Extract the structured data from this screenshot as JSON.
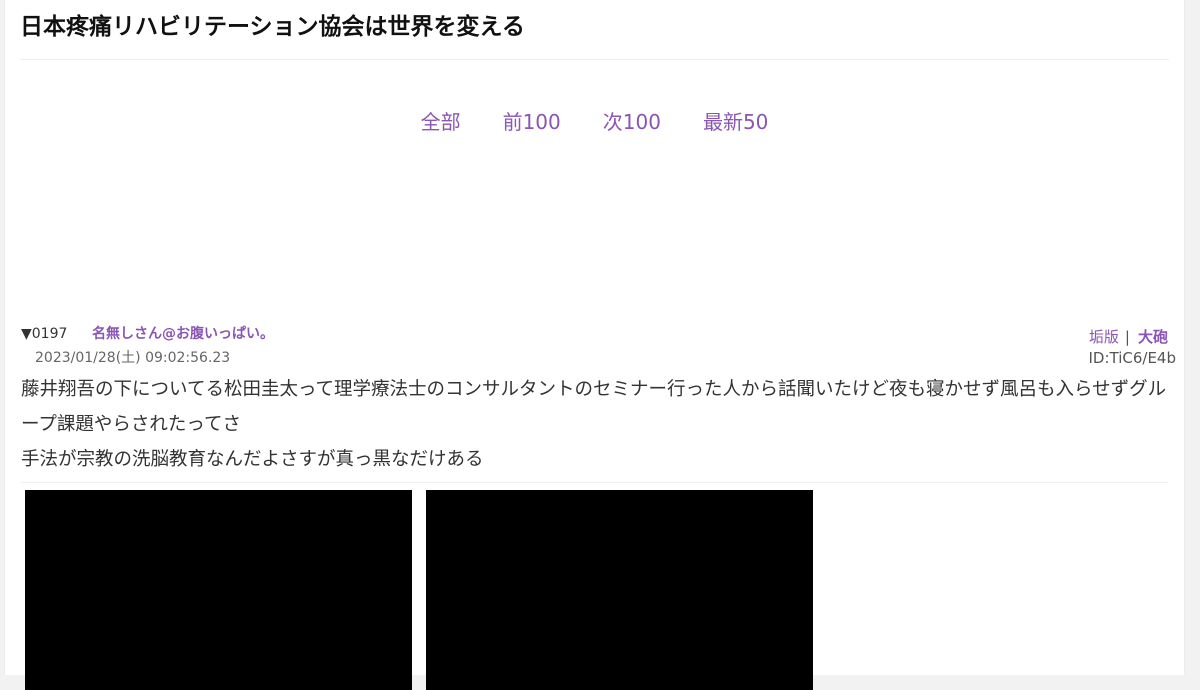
{
  "thread": {
    "title": "日本疼痛リハビリテーション協会は世界を変える"
  },
  "nav": {
    "all": "全部",
    "prev": "前100",
    "next": "次100",
    "latest": "最新50"
  },
  "post": {
    "number": "▼0197",
    "name": "名無しさん@お腹いっぱい。",
    "links": {
      "archive": "垢版",
      "separator": "|",
      "cannon": "大砲"
    },
    "date": "2023/01/28(土) 09:02:56.23",
    "id": "ID:TiC6/E4b",
    "body": [
      "藤井翔吾の下についてる松田圭太って理学療法士のコンサルタントのセミナー行った人から話聞いたけど夜も寝かせず風呂も入らせずグループ課題やらされたってさ",
      "手法が宗教の洗脳教育なんだよさすが真っ黒なだけある"
    ]
  },
  "colors": {
    "link": "#8a55b5",
    "media": "#000000"
  }
}
